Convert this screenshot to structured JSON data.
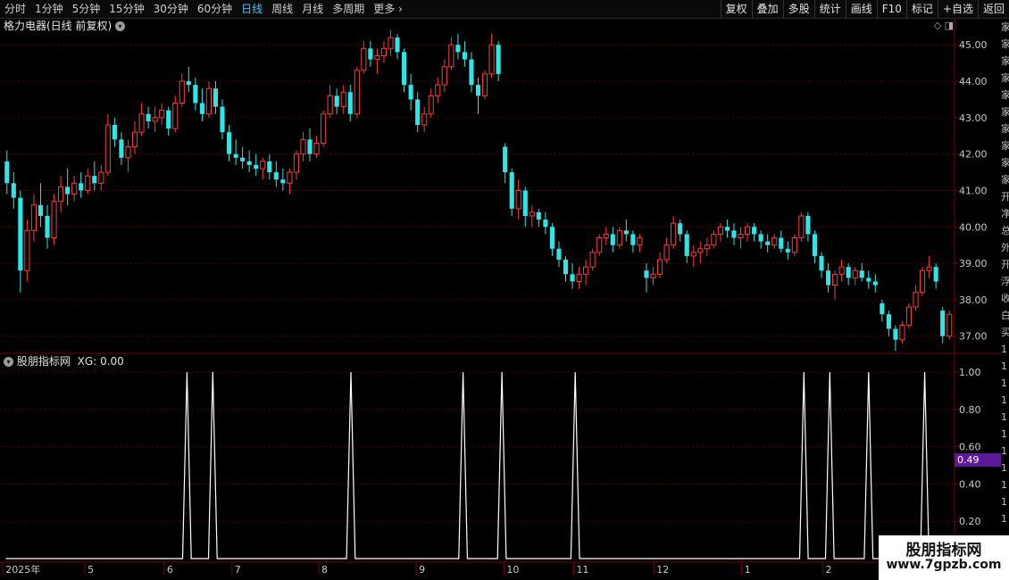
{
  "toolbar": {
    "periods": [
      "分时",
      "1分钟",
      "5分钟",
      "15分钟",
      "30分钟",
      "60分钟",
      "日线",
      "周线",
      "月线",
      "多周期",
      "更多"
    ],
    "active_period": "日线",
    "more_chevron": "chevron-right-icon",
    "buttons": [
      "复权",
      "叠加",
      "多股",
      "统计",
      "画线",
      "F10",
      "标记",
      "+自选",
      "返回"
    ]
  },
  "chart_title": "格力电器(日线 前复权)",
  "title_chevron": "chevron-down-icon",
  "top_icons": [
    "diamond-icon",
    "panel-toggle-icon"
  ],
  "price_axis": {
    "ticks": [
      "45.00",
      "44.00",
      "43.00",
      "42.00",
      "41.00",
      "40.00",
      "39.00",
      "38.00",
      "37.00"
    ]
  },
  "indicator": {
    "name": "股朋指标网",
    "label": "XG:",
    "value": "0.00",
    "axis_ticks": [
      "1.00",
      "0.80",
      "0.60",
      "0.40",
      "0.20"
    ],
    "current_tag": "0.49"
  },
  "date_axis": {
    "labels": [
      "2025年",
      "5",
      "6",
      "7",
      "8",
      "9",
      "10",
      "11",
      "12",
      "1",
      "2"
    ]
  },
  "watermark": {
    "line1": "股朋指标网",
    "line2": "www.7gpzb.com"
  },
  "right_strip_chars": [
    "家",
    "家",
    "家",
    "家",
    "家",
    "家",
    "家",
    "家",
    "家",
    "家",
    "开",
    "净",
    "总",
    "外",
    "开",
    "浮",
    "收",
    "白",
    "买",
    "1",
    "1",
    "1",
    "1",
    "1",
    "1",
    "1",
    "1",
    "1",
    "1",
    "1"
  ],
  "colors": {
    "up": "#ff3b3b",
    "down": "#2ee6e6",
    "signal": "#ffffff",
    "grid": "#5a0000",
    "active": "#4fc3ff",
    "tag_bg": "#5a1a9a"
  },
  "chart_data": [
    {
      "type": "candlestick",
      "title": "格力电器(日线 前复权)",
      "ylim": [
        36.6,
        45.3
      ],
      "ohlc": [
        [
          41.8,
          42.1,
          40.9,
          41.2
        ],
        [
          41.2,
          41.5,
          40.5,
          40.8
        ],
        [
          40.8,
          41.0,
          38.2,
          38.8
        ],
        [
          38.8,
          40.2,
          38.5,
          39.9
        ],
        [
          39.9,
          40.9,
          39.6,
          40.6
        ],
        [
          40.6,
          41.2,
          40.0,
          40.3
        ],
        [
          40.3,
          40.6,
          39.4,
          39.7
        ],
        [
          39.7,
          40.9,
          39.5,
          40.7
        ],
        [
          40.7,
          41.4,
          40.4,
          41.1
        ],
        [
          41.1,
          41.6,
          40.6,
          40.9
        ],
        [
          40.9,
          41.4,
          40.7,
          41.2
        ],
        [
          41.2,
          41.5,
          40.8,
          41.0
        ],
        [
          41.0,
          41.6,
          40.9,
          41.4
        ],
        [
          41.4,
          41.8,
          41.0,
          41.2
        ],
        [
          41.2,
          41.7,
          41.0,
          41.5
        ],
        [
          41.5,
          43.1,
          41.4,
          42.8
        ],
        [
          42.8,
          43.0,
          42.2,
          42.4
        ],
        [
          42.4,
          42.6,
          41.7,
          41.9
        ],
        [
          41.9,
          42.4,
          41.5,
          42.2
        ],
        [
          42.2,
          42.9,
          42.0,
          42.6
        ],
        [
          42.6,
          43.4,
          42.5,
          43.1
        ],
        [
          43.1,
          43.3,
          42.7,
          42.9
        ],
        [
          42.9,
          43.3,
          42.6,
          43.0
        ],
        [
          43.0,
          43.4,
          42.8,
          43.2
        ],
        [
          43.2,
          43.3,
          42.5,
          42.7
        ],
        [
          42.7,
          43.6,
          42.6,
          43.4
        ],
        [
          43.4,
          44.2,
          43.3,
          44.0
        ],
        [
          44.0,
          44.4,
          43.7,
          43.9
        ],
        [
          43.9,
          44.1,
          43.2,
          43.4
        ],
        [
          43.4,
          43.8,
          42.9,
          43.1
        ],
        [
          43.1,
          44.0,
          43.0,
          43.8
        ],
        [
          43.8,
          44.0,
          43.1,
          43.3
        ],
        [
          43.3,
          43.5,
          42.4,
          42.6
        ],
        [
          42.6,
          42.8,
          41.8,
          42.0
        ],
        [
          42.0,
          42.4,
          41.7,
          41.9
        ],
        [
          41.9,
          42.2,
          41.6,
          41.8
        ],
        [
          41.8,
          42.1,
          41.5,
          41.7
        ],
        [
          41.7,
          42.0,
          41.4,
          41.6
        ],
        [
          41.6,
          41.9,
          41.3,
          41.8
        ],
        [
          41.8,
          42.0,
          41.3,
          41.5
        ],
        [
          41.5,
          41.8,
          41.1,
          41.3
        ],
        [
          41.3,
          41.6,
          41.0,
          41.2
        ],
        [
          41.2,
          41.6,
          40.9,
          41.5
        ],
        [
          41.5,
          42.1,
          41.3,
          42.0
        ],
        [
          42.0,
          42.6,
          41.8,
          42.4
        ],
        [
          42.4,
          42.7,
          41.8,
          42.0
        ],
        [
          42.0,
          42.5,
          41.9,
          42.3
        ],
        [
          42.3,
          43.2,
          42.2,
          43.1
        ],
        [
          43.1,
          43.9,
          43.0,
          43.6
        ],
        [
          43.6,
          43.8,
          43.1,
          43.3
        ],
        [
          43.3,
          43.9,
          43.1,
          43.7
        ],
        [
          43.7,
          43.9,
          42.9,
          43.1
        ],
        [
          43.1,
          44.4,
          43.0,
          44.3
        ],
        [
          44.3,
          45.1,
          44.2,
          44.9
        ],
        [
          44.9,
          45.1,
          44.4,
          44.6
        ],
        [
          44.6,
          44.9,
          44.2,
          44.7
        ],
        [
          44.7,
          45.1,
          44.5,
          44.9
        ],
        [
          44.9,
          45.4,
          44.7,
          45.2
        ],
        [
          45.2,
          45.3,
          44.6,
          44.8
        ],
        [
          44.8,
          44.9,
          43.7,
          43.9
        ],
        [
          43.9,
          44.2,
          43.2,
          43.5
        ],
        [
          43.5,
          43.7,
          42.6,
          42.8
        ],
        [
          42.8,
          43.3,
          42.6,
          43.1
        ],
        [
          43.1,
          43.8,
          43.0,
          43.6
        ],
        [
          43.6,
          44.1,
          43.4,
          43.9
        ],
        [
          43.9,
          44.6,
          43.7,
          44.4
        ],
        [
          44.4,
          45.2,
          44.3,
          45.0
        ],
        [
          45.0,
          45.3,
          44.6,
          44.8
        ],
        [
          44.8,
          45.1,
          44.4,
          44.6
        ],
        [
          44.6,
          44.8,
          43.7,
          43.9
        ],
        [
          43.9,
          44.1,
          43.1,
          43.6
        ],
        [
          43.6,
          44.3,
          43.5,
          44.2
        ],
        [
          44.2,
          45.3,
          44.1,
          45.0
        ],
        [
          45.0,
          45.1,
          44.0,
          44.2
        ],
        [
          42.2,
          42.3,
          41.2,
          41.5
        ],
        [
          41.5,
          41.6,
          40.3,
          40.5
        ],
        [
          40.5,
          41.3,
          40.2,
          41.0
        ],
        [
          41.0,
          41.1,
          40.0,
          40.3
        ],
        [
          40.3,
          40.6,
          40.0,
          40.4
        ],
        [
          40.4,
          40.5,
          40.0,
          40.2
        ],
        [
          40.2,
          40.4,
          39.8,
          40.0
        ],
        [
          40.0,
          40.1,
          39.2,
          39.4
        ],
        [
          39.4,
          39.6,
          38.9,
          39.1
        ],
        [
          39.1,
          39.2,
          38.5,
          38.7
        ],
        [
          38.7,
          39.0,
          38.3,
          38.5
        ],
        [
          38.5,
          38.9,
          38.3,
          38.7
        ],
        [
          38.7,
          39.1,
          38.4,
          38.9
        ],
        [
          38.9,
          39.4,
          38.8,
          39.3
        ],
        [
          39.3,
          39.8,
          39.2,
          39.7
        ],
        [
          39.7,
          40.0,
          39.5,
          39.8
        ],
        [
          39.8,
          40.0,
          39.3,
          39.5
        ],
        [
          39.5,
          40.0,
          39.4,
          39.9
        ],
        [
          39.9,
          40.2,
          39.6,
          39.8
        ],
        [
          39.8,
          39.9,
          39.3,
          39.5
        ],
        [
          39.5,
          39.8,
          39.3,
          39.7
        ],
        [
          38.8,
          39.0,
          38.2,
          38.6
        ],
        [
          38.6,
          38.9,
          38.4,
          38.7
        ],
        [
          38.7,
          39.3,
          38.6,
          39.1
        ],
        [
          39.1,
          39.7,
          39.0,
          39.5
        ],
        [
          39.5,
          40.3,
          39.4,
          40.1
        ],
        [
          40.1,
          40.2,
          39.6,
          39.8
        ],
        [
          39.8,
          39.9,
          39.0,
          39.2
        ],
        [
          39.2,
          39.5,
          38.9,
          39.3
        ],
        [
          39.3,
          39.6,
          39.0,
          39.4
        ],
        [
          39.4,
          39.7,
          39.2,
          39.5
        ],
        [
          39.5,
          39.9,
          39.4,
          39.8
        ],
        [
          39.8,
          40.1,
          39.6,
          40.0
        ],
        [
          40.0,
          40.2,
          39.7,
          39.9
        ],
        [
          39.9,
          40.1,
          39.5,
          39.7
        ],
        [
          39.7,
          40.0,
          39.4,
          39.8
        ],
        [
          39.8,
          40.1,
          39.6,
          40.0
        ],
        [
          40.0,
          40.1,
          39.6,
          39.8
        ],
        [
          39.8,
          39.9,
          39.4,
          39.6
        ],
        [
          39.6,
          39.8,
          39.3,
          39.5
        ],
        [
          39.5,
          39.8,
          39.4,
          39.7
        ],
        [
          39.7,
          39.9,
          39.3,
          39.4
        ],
        [
          39.4,
          39.6,
          39.1,
          39.3
        ],
        [
          39.3,
          39.8,
          39.2,
          39.7
        ],
        [
          39.7,
          40.4,
          39.6,
          40.3
        ],
        [
          40.3,
          40.4,
          39.6,
          39.8
        ],
        [
          39.8,
          39.9,
          39.0,
          39.2
        ],
        [
          39.2,
          39.3,
          38.6,
          38.8
        ],
        [
          38.8,
          39.0,
          38.2,
          38.4
        ],
        [
          38.4,
          38.8,
          38.0,
          38.7
        ],
        [
          38.7,
          39.1,
          38.5,
          38.9
        ],
        [
          38.9,
          39.0,
          38.4,
          38.6
        ],
        [
          38.6,
          38.9,
          38.4,
          38.8
        ],
        [
          38.8,
          39.0,
          38.5,
          38.6
        ],
        [
          38.6,
          38.8,
          38.3,
          38.5
        ],
        [
          38.5,
          38.7,
          38.2,
          38.4
        ],
        [
          37.9,
          38.0,
          37.4,
          37.6
        ],
        [
          37.6,
          37.7,
          37.0,
          37.2
        ],
        [
          37.2,
          37.3,
          36.6,
          36.9
        ],
        [
          36.9,
          37.4,
          36.8,
          37.3
        ],
        [
          37.3,
          37.9,
          37.2,
          37.8
        ],
        [
          37.8,
          38.4,
          37.7,
          38.2
        ],
        [
          38.2,
          38.9,
          38.1,
          38.8
        ],
        [
          38.8,
          39.2,
          38.6,
          38.9
        ],
        [
          38.9,
          39.0,
          38.3,
          38.5
        ],
        [
          37.7,
          37.8,
          36.8,
          37.0
        ],
        [
          37.0,
          37.7,
          36.9,
          37.6
        ]
      ]
    },
    {
      "type": "line",
      "title": "股朋指标网",
      "series": [
        {
          "name": "XG",
          "values": [
            0,
            0,
            0,
            0,
            0,
            0,
            0,
            0,
            0,
            0,
            0,
            0,
            0,
            0,
            0,
            0,
            0,
            0,
            0,
            0,
            0,
            0,
            0,
            0,
            0,
            0,
            0,
            0,
            0,
            0,
            0,
            0,
            0,
            0,
            0,
            0,
            0,
            0,
            0,
            0,
            0,
            0,
            1,
            0,
            0,
            0,
            0,
            0,
            1,
            0,
            0,
            0,
            0,
            0,
            0,
            0,
            0,
            0,
            0,
            0,
            0,
            0,
            0,
            0,
            0,
            0,
            0,
            0,
            0,
            0,
            0,
            0,
            0,
            0,
            0,
            0,
            0,
            0,
            0,
            0,
            1,
            0,
            0,
            0,
            0,
            0,
            0,
            0,
            0,
            0,
            0,
            0,
            0,
            0,
            0,
            0,
            0,
            0,
            0,
            0,
            0,
            0,
            0,
            0,
            0,
            0,
            1,
            0,
            0,
            0,
            0,
            0,
            0,
            0,
            0,
            1,
            0,
            0,
            0,
            0,
            0,
            0,
            0,
            0,
            0,
            0,
            0,
            0,
            0,
            0,
            0,
            0,
            1,
            0,
            0,
            0,
            0,
            0,
            0,
            0,
            0,
            0,
            0,
            0,
            0,
            0,
            0,
            0,
            0,
            0,
            0,
            0,
            0,
            0,
            0,
            0,
            0,
            0,
            0,
            0,
            0,
            0,
            0,
            0,
            0,
            0,
            0,
            0,
            0,
            0,
            0,
            0,
            0,
            0,
            0,
            0,
            0,
            0,
            0,
            0,
            0,
            0,
            0,
            0,
            0,
            1,
            0,
            0,
            0,
            0,
            0,
            1,
            0,
            0,
            0,
            0,
            0,
            0,
            0,
            0,
            1,
            0,
            0,
            0,
            0,
            0,
            0,
            0,
            0,
            0,
            0,
            0,
            0,
            1,
            0,
            0,
            0,
            0,
            0,
            0
          ]
        }
      ],
      "ylim": [
        0,
        1.0
      ]
    }
  ]
}
